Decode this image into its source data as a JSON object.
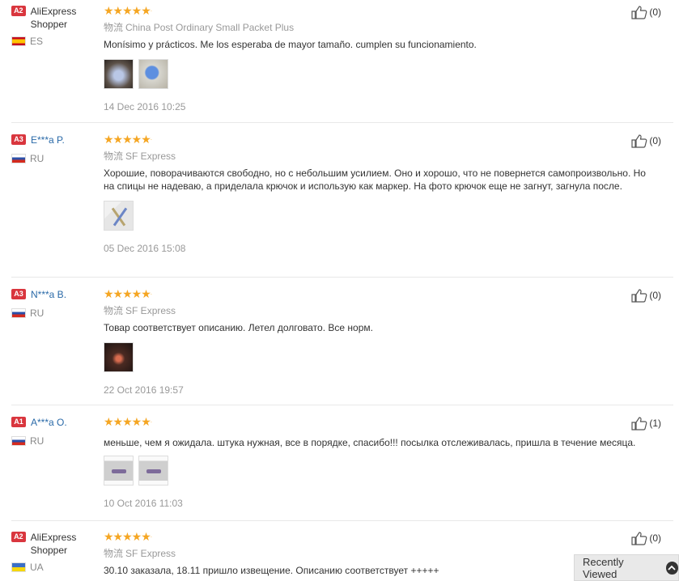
{
  "reviews": [
    {
      "level": "A2",
      "username": "AliExpress Shopper",
      "country": "ES",
      "shipping_cn": "物流",
      "shipping": "China Post Ordinary Small Packet Plus",
      "text": "Monísimo y prácticos. Me los esperaba de mayor tamaño. cumplen su funcionamiento.",
      "date": "14 Dec 2016 10:25",
      "likes": "(0)"
    },
    {
      "level": "A3",
      "username": "E***a P.",
      "country": "RU",
      "shipping_cn": "物流",
      "shipping": "SF Express",
      "text": "Хорошие, поворачиваются свободно, но с небольшим усилием. Оно и хорошо, что не повернется самопроизвольно. Но на спицы не надеваю, а приделала крючок и использую как маркер. На фото крючок еще не загнут, загнула после.",
      "date": "05 Dec 2016 15:08",
      "likes": "(0)"
    },
    {
      "level": "A3",
      "username": "N***a B.",
      "country": "RU",
      "shipping_cn": "物流",
      "shipping": "SF Express",
      "text": "Товар соответствует описанию. Летел долговато. Все норм.",
      "date": "22 Oct 2016 19:57",
      "likes": "(0)"
    },
    {
      "level": "A1",
      "username": "A***a O.",
      "country": "RU",
      "text": "меньше, чем я ожидала. штука нужная, все в порядке, спасибо!!! посылка отслеживалась, пришла в течение месяца.",
      "date": "10 Oct 2016 11:03",
      "likes": "(1)"
    },
    {
      "level": "A2",
      "username": "AliExpress Shopper",
      "country": "UA",
      "shipping_cn": "物流",
      "shipping": "SF Express",
      "text": "30.10 заказала, 18.11 пришло извещение. Описанию соответствует +++++",
      "likes": "(0)"
    }
  ],
  "recently_viewed": "Recently Viewed",
  "colors": {
    "level_badge": "#d9363e",
    "stars": "#f5a623",
    "link": "#2a6aa8"
  },
  "icons": {
    "like": "thumbs-up-icon",
    "chevron": "chevron-up-icon"
  }
}
